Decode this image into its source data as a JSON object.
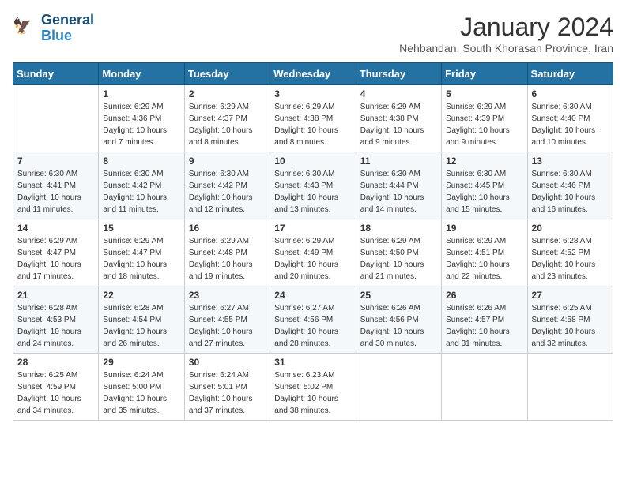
{
  "header": {
    "logo_line1": "General",
    "logo_line2": "Blue",
    "month_title": "January 2024",
    "subtitle": "Nehbandan, South Khorasan Province, Iran"
  },
  "weekdays": [
    "Sunday",
    "Monday",
    "Tuesday",
    "Wednesday",
    "Thursday",
    "Friday",
    "Saturday"
  ],
  "weeks": [
    [
      {
        "day": "",
        "info": ""
      },
      {
        "day": "1",
        "info": "Sunrise: 6:29 AM\nSunset: 4:36 PM\nDaylight: 10 hours\nand 7 minutes."
      },
      {
        "day": "2",
        "info": "Sunrise: 6:29 AM\nSunset: 4:37 PM\nDaylight: 10 hours\nand 8 minutes."
      },
      {
        "day": "3",
        "info": "Sunrise: 6:29 AM\nSunset: 4:38 PM\nDaylight: 10 hours\nand 8 minutes."
      },
      {
        "day": "4",
        "info": "Sunrise: 6:29 AM\nSunset: 4:38 PM\nDaylight: 10 hours\nand 9 minutes."
      },
      {
        "day": "5",
        "info": "Sunrise: 6:29 AM\nSunset: 4:39 PM\nDaylight: 10 hours\nand 9 minutes."
      },
      {
        "day": "6",
        "info": "Sunrise: 6:30 AM\nSunset: 4:40 PM\nDaylight: 10 hours\nand 10 minutes."
      }
    ],
    [
      {
        "day": "7",
        "info": "Sunrise: 6:30 AM\nSunset: 4:41 PM\nDaylight: 10 hours\nand 11 minutes."
      },
      {
        "day": "8",
        "info": "Sunrise: 6:30 AM\nSunset: 4:42 PM\nDaylight: 10 hours\nand 11 minutes."
      },
      {
        "day": "9",
        "info": "Sunrise: 6:30 AM\nSunset: 4:42 PM\nDaylight: 10 hours\nand 12 minutes."
      },
      {
        "day": "10",
        "info": "Sunrise: 6:30 AM\nSunset: 4:43 PM\nDaylight: 10 hours\nand 13 minutes."
      },
      {
        "day": "11",
        "info": "Sunrise: 6:30 AM\nSunset: 4:44 PM\nDaylight: 10 hours\nand 14 minutes."
      },
      {
        "day": "12",
        "info": "Sunrise: 6:30 AM\nSunset: 4:45 PM\nDaylight: 10 hours\nand 15 minutes."
      },
      {
        "day": "13",
        "info": "Sunrise: 6:30 AM\nSunset: 4:46 PM\nDaylight: 10 hours\nand 16 minutes."
      }
    ],
    [
      {
        "day": "14",
        "info": "Sunrise: 6:29 AM\nSunset: 4:47 PM\nDaylight: 10 hours\nand 17 minutes."
      },
      {
        "day": "15",
        "info": "Sunrise: 6:29 AM\nSunset: 4:47 PM\nDaylight: 10 hours\nand 18 minutes."
      },
      {
        "day": "16",
        "info": "Sunrise: 6:29 AM\nSunset: 4:48 PM\nDaylight: 10 hours\nand 19 minutes."
      },
      {
        "day": "17",
        "info": "Sunrise: 6:29 AM\nSunset: 4:49 PM\nDaylight: 10 hours\nand 20 minutes."
      },
      {
        "day": "18",
        "info": "Sunrise: 6:29 AM\nSunset: 4:50 PM\nDaylight: 10 hours\nand 21 minutes."
      },
      {
        "day": "19",
        "info": "Sunrise: 6:29 AM\nSunset: 4:51 PM\nDaylight: 10 hours\nand 22 minutes."
      },
      {
        "day": "20",
        "info": "Sunrise: 6:28 AM\nSunset: 4:52 PM\nDaylight: 10 hours\nand 23 minutes."
      }
    ],
    [
      {
        "day": "21",
        "info": "Sunrise: 6:28 AM\nSunset: 4:53 PM\nDaylight: 10 hours\nand 24 minutes."
      },
      {
        "day": "22",
        "info": "Sunrise: 6:28 AM\nSunset: 4:54 PM\nDaylight: 10 hours\nand 26 minutes."
      },
      {
        "day": "23",
        "info": "Sunrise: 6:27 AM\nSunset: 4:55 PM\nDaylight: 10 hours\nand 27 minutes."
      },
      {
        "day": "24",
        "info": "Sunrise: 6:27 AM\nSunset: 4:56 PM\nDaylight: 10 hours\nand 28 minutes."
      },
      {
        "day": "25",
        "info": "Sunrise: 6:26 AM\nSunset: 4:56 PM\nDaylight: 10 hours\nand 30 minutes."
      },
      {
        "day": "26",
        "info": "Sunrise: 6:26 AM\nSunset: 4:57 PM\nDaylight: 10 hours\nand 31 minutes."
      },
      {
        "day": "27",
        "info": "Sunrise: 6:25 AM\nSunset: 4:58 PM\nDaylight: 10 hours\nand 32 minutes."
      }
    ],
    [
      {
        "day": "28",
        "info": "Sunrise: 6:25 AM\nSunset: 4:59 PM\nDaylight: 10 hours\nand 34 minutes."
      },
      {
        "day": "29",
        "info": "Sunrise: 6:24 AM\nSunset: 5:00 PM\nDaylight: 10 hours\nand 35 minutes."
      },
      {
        "day": "30",
        "info": "Sunrise: 6:24 AM\nSunset: 5:01 PM\nDaylight: 10 hours\nand 37 minutes."
      },
      {
        "day": "31",
        "info": "Sunrise: 6:23 AM\nSunset: 5:02 PM\nDaylight: 10 hours\nand 38 minutes."
      },
      {
        "day": "",
        "info": ""
      },
      {
        "day": "",
        "info": ""
      },
      {
        "day": "",
        "info": ""
      }
    ]
  ]
}
